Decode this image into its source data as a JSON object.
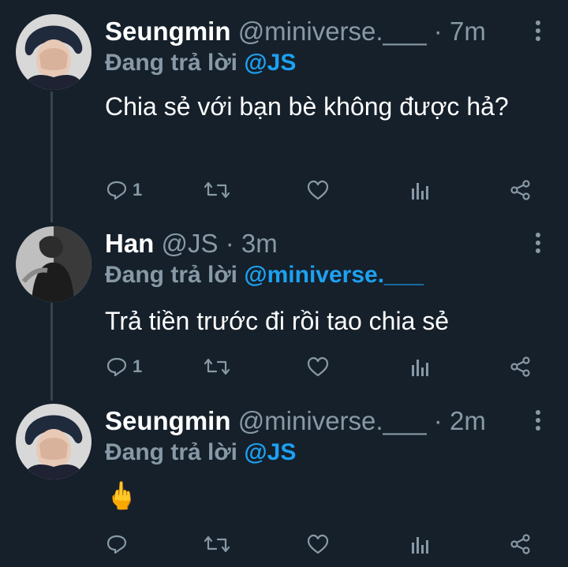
{
  "colors": {
    "background": "#15202b",
    "muted": "#8899a6",
    "mention": "#1da1f2",
    "thread_line": "#38444d"
  },
  "tweets": [
    {
      "name": "Seungmin",
      "handle": "@miniverse.___",
      "dot": "·",
      "time": "7m",
      "reply_prefix": "Đang trả lời",
      "reply_to": "@JS",
      "text": "Chia sẻ với bạn bè không được hả?",
      "reply_count": "1",
      "avatar": "seungmin-avatar"
    },
    {
      "name": "Han",
      "handle": "@JS",
      "dot": "·",
      "time": "3m",
      "reply_prefix": "Đang trả lời",
      "reply_to": "@miniverse.___",
      "text": "Trả tiền trước đi rồi tao chia sẻ",
      "reply_count": "1",
      "avatar": "han-avatar"
    },
    {
      "name": "Seungmin",
      "handle": "@miniverse.___",
      "dot": "·",
      "time": "2m",
      "reply_prefix": "Đang trả lời",
      "reply_to": "@JS",
      "text": "🖕",
      "reply_count": "",
      "avatar": "seungmin-avatar"
    }
  ],
  "icons": [
    "reply-icon",
    "retweet-icon",
    "like-icon",
    "analytics-icon",
    "share-icon",
    "more-icon"
  ]
}
